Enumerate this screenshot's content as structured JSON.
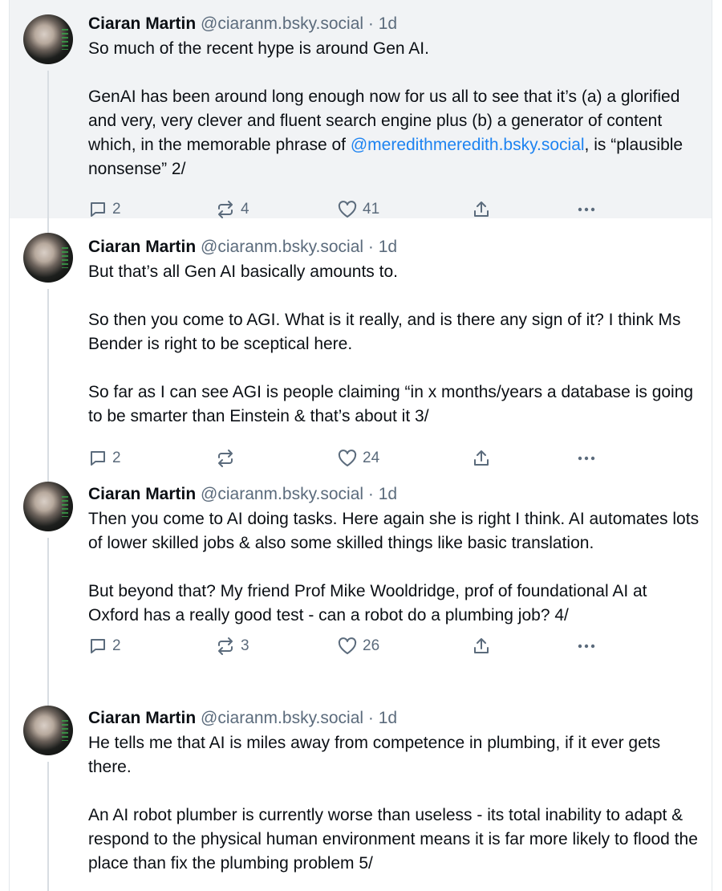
{
  "posts": [
    {
      "author": "Ciaran Martin",
      "handle": "@ciaranm.bsky.social",
      "time": "1d",
      "paragraphs": [
        [
          "So much of the recent hype is around Gen AI."
        ],
        [
          "GenAI has been around long enough now for us all to see that it’s (a) a glorified and very, very clever and fluent search engine plus (b) a generator of content which, in the memorable phrase of ",
          "@meredithmeredith.bsky.social",
          ", is “plausible nonsense” 2/"
        ]
      ],
      "replies": "2",
      "reposts": "4",
      "likes": "41"
    },
    {
      "author": "Ciaran Martin",
      "handle": "@ciaranm.bsky.social",
      "time": "1d",
      "paragraphs": [
        [
          "But that’s all Gen AI basically amounts to."
        ],
        [
          "So then you come to AGI. What is it really, and is there any sign of it? I think Ms Bender is right to be sceptical here."
        ],
        [
          "So far as I can see AGI is people claiming “in x months/years a database is going to be smarter than Einstein & that’s about it 3/"
        ]
      ],
      "replies": "2",
      "reposts": "",
      "likes": "24"
    },
    {
      "author": "Ciaran Martin",
      "handle": "@ciaranm.bsky.social",
      "time": "1d",
      "paragraphs": [
        [
          "Then you come to AI doing tasks. Here again she is right I think. AI automates lots of lower skilled jobs & also some skilled things like basic translation."
        ],
        [
          "But beyond that? My friend Prof Mike Wooldridge, prof of foundational AI at Oxford has a really good test - can a robot do a plumbing job? 4/"
        ]
      ],
      "replies": "2",
      "reposts": "3",
      "likes": "26"
    },
    {
      "author": "Ciaran Martin",
      "handle": "@ciaranm.bsky.social",
      "time": "1d",
      "paragraphs": [
        [
          "He tells me that AI is miles away from competence in plumbing, if it ever gets there."
        ],
        [
          "An AI robot plumber is currently worse than useless - its total inability to adapt & respond to the physical human environment means it is far more likely to flood the place than fix the plumbing problem 5/"
        ]
      ],
      "replies": "",
      "reposts": "",
      "likes": ""
    }
  ],
  "separator": " · ",
  "icons": {
    "reply": "speech-bubble-icon",
    "repost": "repost-arrows-icon",
    "like": "heart-icon",
    "share": "share-upload-icon",
    "more": "ellipsis-icon"
  },
  "colors": {
    "mention": "#1d83f1",
    "muted": "#5b6b7c",
    "highlight_bg": "#f1f3f5"
  }
}
